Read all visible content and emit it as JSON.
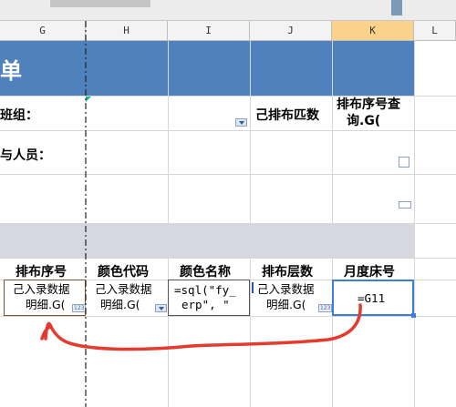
{
  "columns": [
    "G",
    "H",
    "I",
    "J",
    "K",
    "L"
  ],
  "title_fragment": "单",
  "row_labels": {
    "team": "班组：",
    "personnel": "与人员："
  },
  "labels": {
    "arranged_layers": "己排布匹数",
    "query_line1": "排布序号查",
    "query_line2": "询.G("
  },
  "headers": [
    "排布序号",
    "颜色代码",
    "颜色名称",
    "排布层数",
    "月度床号"
  ],
  "data_cells": {
    "g": [
      "己入录数据",
      "明细.G("
    ],
    "h": [
      "己入录数据",
      "明细.G("
    ],
    "i": [
      "=sql(\"fy_",
      "erp\", \""
    ],
    "j": [
      "己入录数据",
      "明细.G("
    ],
    "k": "=G11"
  },
  "icon_text": "123",
  "colors": {
    "accent_band": "#4f81bd",
    "selected_header": "#fbd28a",
    "selected_cell": "#3b7fd8",
    "annotation_curve": "#e53b2e"
  },
  "icons": [
    "dropdown-icon",
    "number-type-icon",
    "arrow-annotation"
  ]
}
